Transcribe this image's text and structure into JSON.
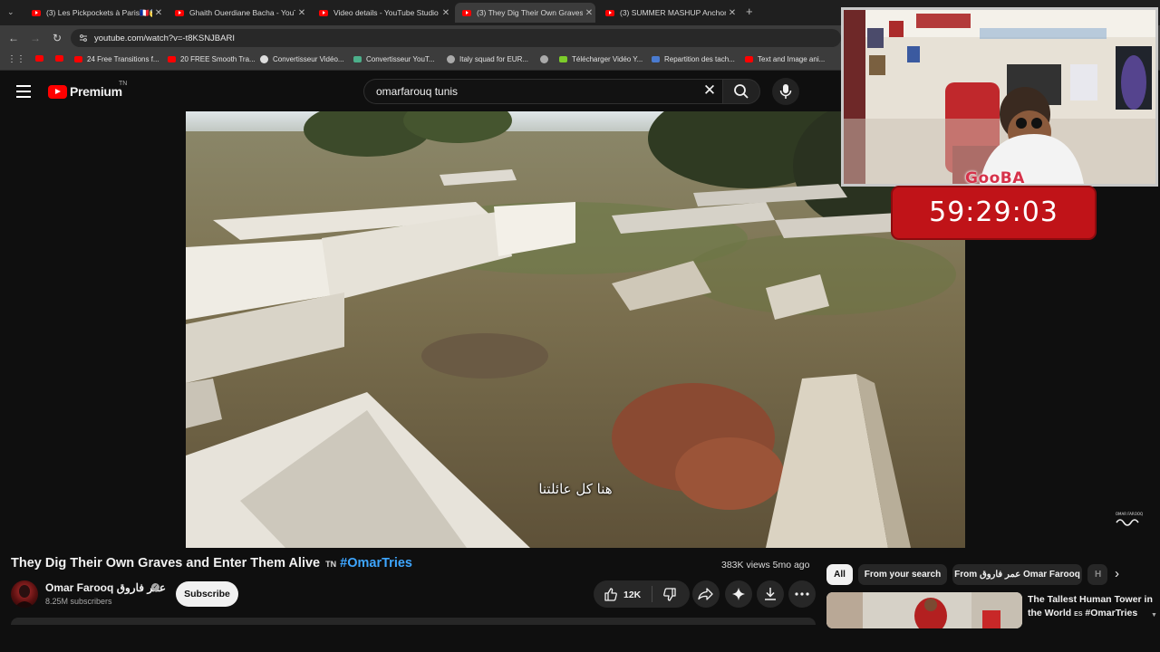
{
  "browser": {
    "tabs": [
      {
        "title": "(3) Les Pickpockets à Paris🇫🇷😱",
        "active": false
      },
      {
        "title": "Ghaith Ouerdiane Bacha - YouT",
        "active": false
      },
      {
        "title": "Video details - YouTube Studio",
        "active": false
      },
      {
        "title": "(3) They Dig Their Own Graves a",
        "active": true
      },
      {
        "title": "(3) SUMMER MASHUP Anchor (",
        "active": false
      }
    ],
    "new_tab": "+",
    "tab_close": "✕",
    "url": "youtube.com/watch?v=-t8KSNJBARI",
    "bookmarks": [
      {
        "label": "",
        "color": "#ff0000"
      },
      {
        "label": "",
        "color": "#ff0000"
      },
      {
        "label": "24 Free Transitions f...",
        "color": "#ff0000"
      },
      {
        "label": "20 FREE Smooth Tra...",
        "color": "#ff0000"
      },
      {
        "label": "Convertisseur Vidéo...",
        "color": "#dddddd"
      },
      {
        "label": "Convertisseur YouT...",
        "color": "#4caf8a"
      },
      {
        "label": "Italy squad for EUR...",
        "color": "#aaaaaa"
      },
      {
        "label": "",
        "color": "#aaaaaa"
      },
      {
        "label": "Télécharger Vidéo Y...",
        "color": "#7ccc2a"
      },
      {
        "label": "Repartition des tach...",
        "color": "#4a7bd0"
      },
      {
        "label": "Text and Image ani...",
        "color": "#ff0000"
      }
    ]
  },
  "youtube": {
    "logo_word": "Premium",
    "logo_country": "TN",
    "search_value": "omarfarouq tunis",
    "icons": {
      "menu": "menu-icon",
      "clear": "close-icon",
      "search": "search-icon",
      "mic": "mic-icon"
    }
  },
  "video": {
    "caption": "هنا كل عائلتنا",
    "title_main": "They Dig Their Own Graves and Enter Them Alive",
    "title_flag": "TN",
    "title_tag": "#OmarTries",
    "views": "383K views  5mo ago",
    "channel_name": "Omar Farooq عمر فاروق",
    "verified_mark": "✓",
    "subscribers": "8.25M subscribers",
    "subscribe_label": "Subscribe",
    "like_count": "12K"
  },
  "stream_overlay": {
    "streamer_name": "GooBA",
    "timer": "59:29:03"
  },
  "sidebar": {
    "chips": [
      {
        "label": "All",
        "selected": true
      },
      {
        "label": "From your search",
        "selected": false
      },
      {
        "label": "From عمر فاروق Omar Farooq",
        "selected": false
      },
      {
        "label": "H",
        "selected": false
      }
    ],
    "next_arrow": "›",
    "recommended": [
      {
        "title": "The Tallest Human Tower in the World",
        "flag": "ES",
        "tag": "#OmarTries"
      }
    ]
  }
}
